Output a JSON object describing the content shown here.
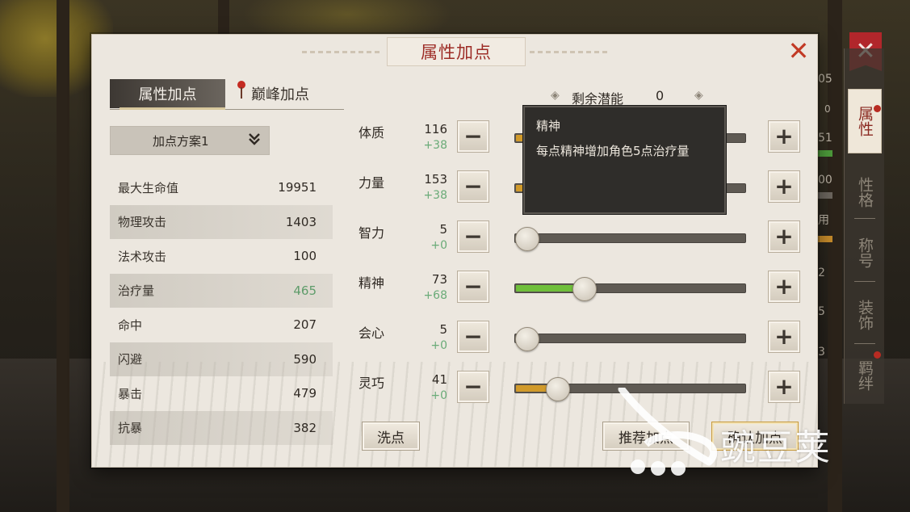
{
  "panel": {
    "title": "属性加点",
    "close_glyph": "✕"
  },
  "tabs": [
    {
      "label": "属性加点",
      "active": true
    },
    {
      "label": "巅峰加点",
      "active": false
    }
  ],
  "plan_select": {
    "label": "加点方案1",
    "icon": "chevron-double-down-icon"
  },
  "stats": [
    {
      "name": "最大生命值",
      "value": "19951"
    },
    {
      "name": "物理攻击",
      "value": "1403"
    },
    {
      "name": "法术攻击",
      "value": "100"
    },
    {
      "name": "治疗量",
      "value": "465",
      "color": "#5e9c6a"
    },
    {
      "name": "命中",
      "value": "207"
    },
    {
      "name": "闪避",
      "value": "590"
    },
    {
      "name": "暴击",
      "value": "479"
    },
    {
      "name": "抗暴",
      "value": "382"
    }
  ],
  "remaining_potential": {
    "label": "剩余潜能",
    "value": "0"
  },
  "attributes": [
    {
      "name": "体质",
      "value": "116",
      "bonus": "+38",
      "level": 0.13,
      "fill_color": "#d19a2a"
    },
    {
      "name": "力量",
      "value": "153",
      "bonus": "+38",
      "level": 0.13,
      "fill_color": "#d19a2a"
    },
    {
      "name": "智力",
      "value": "5",
      "bonus": "+0",
      "level": 0.0,
      "fill_color": "#d19a2a"
    },
    {
      "name": "精神",
      "value": "73",
      "bonus": "+68",
      "level": 0.28,
      "fill_color": "#6fbf3a"
    },
    {
      "name": "会心",
      "value": "5",
      "bonus": "+0",
      "level": 0.0,
      "fill_color": "#d19a2a"
    },
    {
      "name": "灵巧",
      "value": "41",
      "bonus": "+0",
      "level": 0.15,
      "fill_color": "#d19a2a"
    }
  ],
  "tooltip": {
    "title": "精神",
    "body": "每点精神增加角色5点治疗量"
  },
  "buttons": {
    "wash": "洗点",
    "recommend": "推荐加点",
    "confirm": "确认加点"
  },
  "side_tabs": [
    {
      "label": "属性",
      "active": true
    },
    {
      "label": "性格",
      "active": false
    },
    {
      "label": "称号",
      "active": false
    },
    {
      "label": "装饰",
      "active": false
    },
    {
      "label": "羁绊",
      "active": false
    }
  ],
  "background_peek": [
    "05",
    "0",
    "51",
    "00",
    "用",
    "2",
    "5",
    "3"
  ],
  "watermark": {
    "text": "豌豆荚"
  },
  "colors": {
    "title_red": "#9d2c26",
    "bonus_green": "#6aab78",
    "close_red": "#c23a25"
  }
}
